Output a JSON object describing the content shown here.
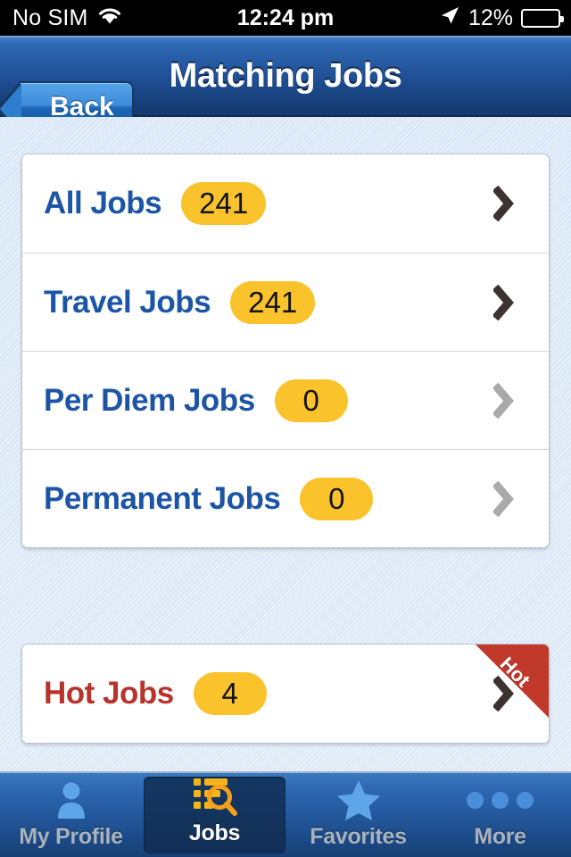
{
  "status_bar": {
    "carrier": "No SIM",
    "wifi_icon": "wifi-icon",
    "time": "12:24 pm",
    "location_icon": "location-arrow-icon",
    "battery_percent": "12%",
    "battery_level": 12,
    "battery_color": "#ef2b24"
  },
  "nav_bar": {
    "back_label": "Back",
    "title": "Matching Jobs",
    "background_color": "#1f4e93"
  },
  "job_categories": [
    {
      "label": "All Jobs",
      "count": "241",
      "enabled": true,
      "chevron": "chevron-right-icon"
    },
    {
      "label": "Travel Jobs",
      "count": "241",
      "enabled": true,
      "chevron": "chevron-right-icon"
    },
    {
      "label": "Per Diem Jobs",
      "count": "0",
      "enabled": false,
      "chevron": "chevron-right-icon"
    },
    {
      "label": "Permanent Jobs",
      "count": "0",
      "enabled": false,
      "chevron": "chevron-right-icon"
    }
  ],
  "hot_jobs": {
    "label": "Hot Jobs",
    "count": "4",
    "ribbon_label": "Hot",
    "label_color": "#b8332c",
    "ribbon_color": "#c0392b",
    "chevron": "chevron-right-icon"
  },
  "badge_color": "#fac22b",
  "tabs": [
    {
      "label": "My Profile",
      "icon": "person-icon",
      "active": false
    },
    {
      "label": "Jobs",
      "icon": "job-search-icon",
      "active": true
    },
    {
      "label": "Favorites",
      "icon": "star-icon",
      "active": false
    },
    {
      "label": "More",
      "icon": "ellipsis-icon",
      "active": false
    }
  ]
}
